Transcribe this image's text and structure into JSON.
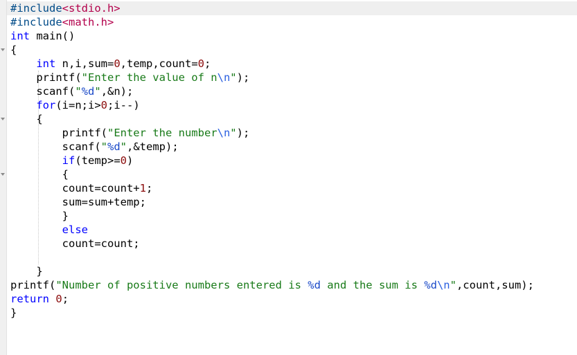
{
  "editor": {
    "colors": {
      "background": "#ffffff",
      "gutter": "#f0f0f0",
      "current_line": "#efefef",
      "keyword": "#0000ff",
      "preprocessor": "#004b88",
      "string": "#187a18",
      "number": "#8a0a0a",
      "format_spec": "#1a49c8",
      "escape": "#2a5fe0",
      "plain": "#000000"
    },
    "lines": [
      [
        {
          "t": "#include",
          "c": "#004b88"
        },
        {
          "t": "<stdio.h>",
          "c": "#b3004b"
        }
      ],
      [
        {
          "t": "#include",
          "c": "#004b88"
        },
        {
          "t": "<math.h>",
          "c": "#b3004b"
        }
      ],
      [
        {
          "t": "int",
          "c": "#0000ff"
        },
        {
          "t": " main()",
          "c": "#000000"
        }
      ],
      [
        {
          "t": "{",
          "c": "#000000"
        }
      ],
      [
        {
          "t": "    ",
          "c": "#000000"
        },
        {
          "t": "int",
          "c": "#0000ff"
        },
        {
          "t": " n,i,sum=",
          "c": "#000000"
        },
        {
          "t": "0",
          "c": "#8a0a0a"
        },
        {
          "t": ",temp,count=",
          "c": "#000000"
        },
        {
          "t": "0",
          "c": "#8a0a0a"
        },
        {
          "t": ";",
          "c": "#000000"
        }
      ],
      [
        {
          "t": "    printf(",
          "c": "#000000"
        },
        {
          "t": "\"Enter the value of n",
          "c": "#187a18"
        },
        {
          "t": "\\n",
          "c": "#2a5fe0"
        },
        {
          "t": "\"",
          "c": "#187a18"
        },
        {
          "t": ");",
          "c": "#000000"
        }
      ],
      [
        {
          "t": "    scanf(",
          "c": "#000000"
        },
        {
          "t": "\"",
          "c": "#187a18"
        },
        {
          "t": "%d",
          "c": "#1a49c8"
        },
        {
          "t": "\"",
          "c": "#187a18"
        },
        {
          "t": ",&n);",
          "c": "#000000"
        }
      ],
      [
        {
          "t": "    ",
          "c": "#000000"
        },
        {
          "t": "for",
          "c": "#0000ff"
        },
        {
          "t": "(i=n;i>",
          "c": "#000000"
        },
        {
          "t": "0",
          "c": "#8a0a0a"
        },
        {
          "t": ";i--)",
          "c": "#000000"
        }
      ],
      [
        {
          "t": "    {",
          "c": "#000000"
        }
      ],
      [
        {
          "t": "        printf(",
          "c": "#000000"
        },
        {
          "t": "\"Enter the number",
          "c": "#187a18"
        },
        {
          "t": "\\n",
          "c": "#2a5fe0"
        },
        {
          "t": "\"",
          "c": "#187a18"
        },
        {
          "t": ");",
          "c": "#000000"
        }
      ],
      [
        {
          "t": "        scanf(",
          "c": "#000000"
        },
        {
          "t": "\"",
          "c": "#187a18"
        },
        {
          "t": "%d",
          "c": "#1a49c8"
        },
        {
          "t": "\"",
          "c": "#187a18"
        },
        {
          "t": ",&temp);",
          "c": "#000000"
        }
      ],
      [
        {
          "t": "        ",
          "c": "#000000"
        },
        {
          "t": "if",
          "c": "#0000ff"
        },
        {
          "t": "(temp>=",
          "c": "#000000"
        },
        {
          "t": "0",
          "c": "#8a0a0a"
        },
        {
          "t": ")",
          "c": "#000000"
        }
      ],
      [
        {
          "t": "        {",
          "c": "#000000"
        }
      ],
      [
        {
          "t": "        count=count+",
          "c": "#000000"
        },
        {
          "t": "1",
          "c": "#8a0a0a"
        },
        {
          "t": ";",
          "c": "#000000"
        }
      ],
      [
        {
          "t": "        sum=sum+temp;",
          "c": "#000000"
        }
      ],
      [
        {
          "t": "        }",
          "c": "#000000"
        }
      ],
      [
        {
          "t": "        ",
          "c": "#000000"
        },
        {
          "t": "else",
          "c": "#0000ff"
        }
      ],
      [
        {
          "t": "        count=count;",
          "c": "#000000"
        }
      ],
      [
        {
          "t": "",
          "c": "#000000"
        }
      ],
      [
        {
          "t": "    }",
          "c": "#000000"
        }
      ],
      [
        {
          "t": "printf(",
          "c": "#000000"
        },
        {
          "t": "\"Number of positive numbers entered is ",
          "c": "#187a18"
        },
        {
          "t": "%d",
          "c": "#1a49c8"
        },
        {
          "t": " and the sum is ",
          "c": "#187a18"
        },
        {
          "t": "%d",
          "c": "#1a49c8"
        },
        {
          "t": "\\n",
          "c": "#2a5fe0"
        },
        {
          "t": "\"",
          "c": "#187a18"
        },
        {
          "t": ",count,sum);",
          "c": "#000000"
        }
      ],
      [
        {
          "t": "return",
          "c": "#0000ff"
        },
        {
          "t": " ",
          "c": "#000000"
        },
        {
          "t": "0",
          "c": "#8a0a0a"
        },
        {
          "t": ";",
          "c": "#000000"
        }
      ],
      [
        {
          "t": "}",
          "c": "#000000"
        }
      ]
    ]
  }
}
